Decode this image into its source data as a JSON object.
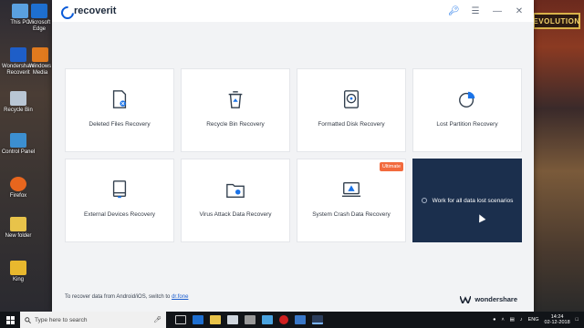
{
  "app": {
    "name": "recoverit",
    "brand": "wondershare",
    "footer_prefix": "To recover data from Android/iOS, switch to ",
    "footer_link": "dr.fone"
  },
  "cards": [
    {
      "label": "Deleted Files Recovery",
      "icon": "deleted-file-icon"
    },
    {
      "label": "Recycle Bin Recovery",
      "icon": "recycle-bin-icon"
    },
    {
      "label": "Formatted Disk Recovery",
      "icon": "disk-icon"
    },
    {
      "label": "Lost Partition Recovery",
      "icon": "partition-pie-icon"
    },
    {
      "label": "External Devices Recovery",
      "icon": "external-device-icon"
    },
    {
      "label": "Virus Attack Data Recovery",
      "icon": "virus-folder-icon"
    },
    {
      "label": "System Crash Data Recovery",
      "icon": "system-crash-icon",
      "badge": "Ultimate"
    },
    {
      "label": "Work for all data lost scenarios",
      "icon": "all-scenarios-icon",
      "selected": true
    }
  ],
  "desktop_icons": [
    {
      "label": "This PC"
    },
    {
      "label": "Microsoft Edge"
    },
    {
      "label": "Wondershare Recoverit"
    },
    {
      "label": "Windows Media"
    },
    {
      "label": "Recycle Bin"
    },
    {
      "label": "Control Panel"
    },
    {
      "label": "Firefox"
    },
    {
      "label": "New folder"
    },
    {
      "label": "King"
    }
  ],
  "taskbar": {
    "search_placeholder": "Type here to search",
    "lang": "ENG",
    "time": "14:24",
    "date": "02-12-2018"
  },
  "colors": {
    "accent": "#0a5bd8",
    "selected_card": "#1b2f4d",
    "badge": "#f26a3d"
  }
}
